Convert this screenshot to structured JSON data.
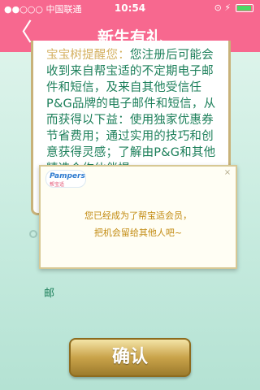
{
  "status_bar": {
    "carrier": "●●○○○ 中国联通",
    "time": "10:54",
    "right_indicators": "⊙ ⚡"
  },
  "nav": {
    "back_icon": "chevron-left-icon",
    "back_glyph": "〈",
    "title": "新生有礼"
  },
  "content": {
    "reminder_label": "宝宝树提醒您：",
    "body": "您注册后可能会收到来自帮宝适的不定期电子邮件和短信，及来自其他受信任P&G品牌的电子邮件和短信，从而获得以下益：使用独家优惠券节省费用；通过实用的技巧和创意获得灵感；了解由P&G和其他精选合作伙伴提",
    "partial_line": "邮"
  },
  "popup": {
    "logo_brand": "Pampers",
    "logo_brand_cn": "帮宝适",
    "close_glyph": "×",
    "line1": "您已经成为了帮宝适会员，",
    "line2": "把机会留给其他人吧~"
  },
  "confirm": {
    "label": "确认"
  },
  "colors": {
    "nav_bg": "#f7688f",
    "text_green": "#1c7f5a",
    "popup_text": "#c28a10",
    "button_gold": "#c9a34a"
  }
}
